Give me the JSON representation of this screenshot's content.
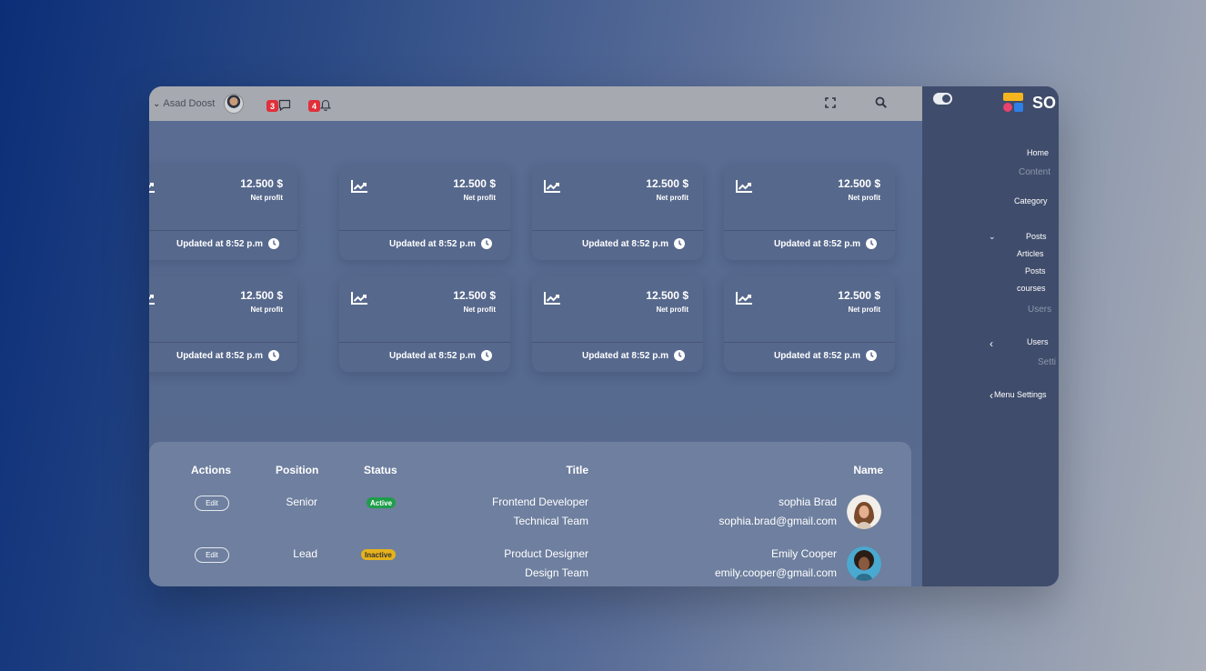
{
  "topbar": {
    "user_name": "Asad Doost",
    "messages_count": "3",
    "notifications_count": "4"
  },
  "cards": [
    {
      "value": "12.500 $",
      "label": "Net profit",
      "updated": "Updated at 8:52 p.m"
    },
    {
      "value": "12.500 $",
      "label": "Net profit",
      "updated": "Updated at 8:52 p.m"
    },
    {
      "value": "12.500 $",
      "label": "Net profit",
      "updated": "Updated at 8:52 p.m"
    },
    {
      "value": "12.500 $",
      "label": "Net profit",
      "updated": "Updated at 8:52 p.m"
    },
    {
      "value": "12.500 $",
      "label": "Net profit",
      "updated": "Updated at 8:52 p.m"
    },
    {
      "value": "12.500 $",
      "label": "Net profit",
      "updated": "Updated at 8:52 p.m"
    },
    {
      "value": "12.500 $",
      "label": "Net profit",
      "updated": "Updated at 8:52 p.m"
    },
    {
      "value": "12.500 $",
      "label": "Net profit",
      "updated": "Updated at 8:52 p.m"
    }
  ],
  "table": {
    "headers": {
      "actions": "Actions",
      "position": "Position",
      "status": "Status",
      "title": "Title",
      "name": "Name"
    },
    "rows": [
      {
        "action": "Edit",
        "position": "Senior",
        "status": "Active",
        "title": "Frontend Developer",
        "team": "Technical Team",
        "name": "sophia Brad",
        "email": "sophia.brad@gmail.com"
      },
      {
        "action": "Edit",
        "position": "Lead",
        "status": "Inactive",
        "title": "Product Designer",
        "team": "Design Team",
        "name": "Emily Cooper",
        "email": "emily.cooper@gmail.com"
      }
    ]
  },
  "sidebar": {
    "logo_text": "SO",
    "items": {
      "home": "Home",
      "content": "Content",
      "category": "Category",
      "posts": "Posts",
      "articles": "Articles",
      "posts_sub": "Posts",
      "courses": "courses",
      "users_section": "Users",
      "users": "Users",
      "settings": "Setti",
      "menu_settings": "Menu Settings"
    }
  },
  "colors": {
    "badge": "#e0303a",
    "active": "#1e9e4a",
    "inactive": "#e6b21c",
    "sidebar": "#3f4c6b"
  }
}
